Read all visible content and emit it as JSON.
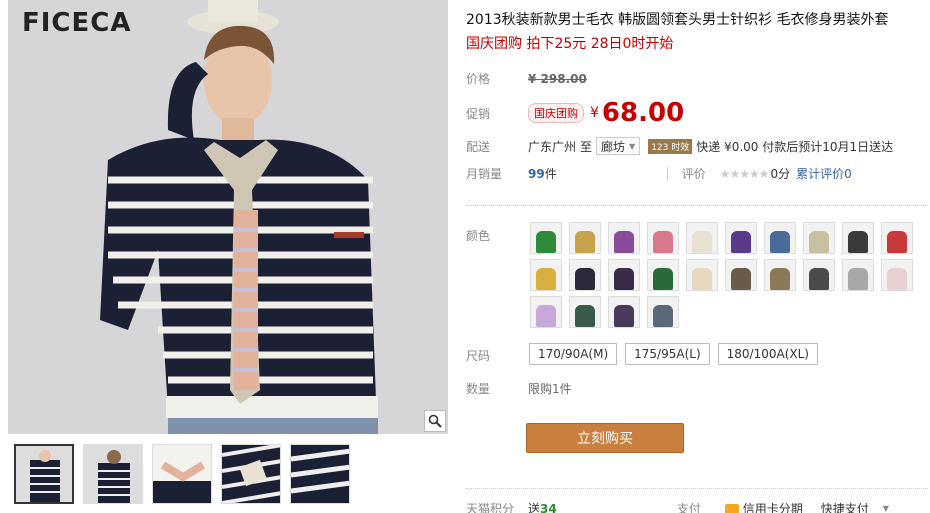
{
  "brand": "FICECA",
  "product": {
    "title": "2013秋装新款男士毛衣 韩版圆领套头男士针织衫 毛衣修身男装外套",
    "promo": "国庆团购 拍下25元 28日0时开始"
  },
  "price": {
    "label": "价格",
    "original": "¥ 298.00"
  },
  "promo_price": {
    "label": "促销",
    "badge": "国庆团购",
    "currency": "¥",
    "value": "68.00"
  },
  "delivery": {
    "label": "配送",
    "from": "广东广州",
    "to_label": "至",
    "to": "廊坊",
    "express_tag": "123 时效",
    "text": "快递 ¥0.00 付款后预计10月1日送达"
  },
  "sales": {
    "label": "月销量",
    "count": "99",
    "unit": "件",
    "rating_label": "评价",
    "stars": "★★★★★",
    "score": "0分",
    "reviews": "累计评价0"
  },
  "color": {
    "label": "颜色",
    "swatch_colors": [
      "#2e8b3a",
      "#c8a24a",
      "#8a4a9a",
      "#d9788a",
      "#e8e0d0",
      "#5a3a8a",
      "#4a6a9a",
      "#c8c0a0",
      "#3a3a3a",
      "#c83a3a",
      "#d8b040",
      "#2a2a3a",
      "#3a2a4a",
      "#2a6a3a",
      "#e8d8c0",
      "#6a5a4a",
      "#8a7a5a",
      "#4a4a4a",
      "#a8a8a8",
      "#e8d0d0",
      "#c8a8d8",
      "#3a5a4a",
      "#4a3a5a",
      "#5a6a7a"
    ]
  },
  "size": {
    "label": "尺码",
    "options": [
      "170/90A(M)",
      "175/95A(L)",
      "180/100A(XL)"
    ]
  },
  "quantity": {
    "label": "数量",
    "limit": "限购1件"
  },
  "buy_button": "立刻购买",
  "footer": {
    "points_label": "天猫积分",
    "points_prefix": "送",
    "points_value": "34",
    "pay_label": "支付",
    "pay_option1": "信用卡分期",
    "pay_option2": "快捷支付"
  }
}
